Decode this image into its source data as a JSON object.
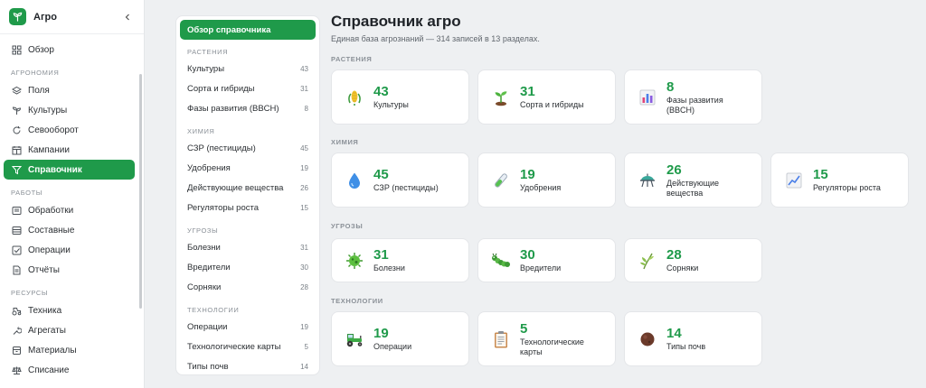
{
  "app": {
    "name": "Агро"
  },
  "sidebar": {
    "overview": "Обзор",
    "sections": [
      {
        "title": "АГРОНОМИЯ",
        "items": [
          {
            "label": "Поля",
            "icon": "layers-icon"
          },
          {
            "label": "Культуры",
            "icon": "sprout-icon"
          },
          {
            "label": "Севооборот",
            "icon": "rotate-icon"
          },
          {
            "label": "Кампании",
            "icon": "calendar-icon"
          },
          {
            "label": "Справочник",
            "icon": "funnel-icon",
            "active": true
          }
        ]
      },
      {
        "title": "РАБОТЫ",
        "items": [
          {
            "label": "Обработки",
            "icon": "list-icon"
          },
          {
            "label": "Составные",
            "icon": "stack-icon"
          },
          {
            "label": "Операции",
            "icon": "checkbox-icon"
          },
          {
            "label": "Отчёты",
            "icon": "document-icon"
          }
        ]
      },
      {
        "title": "РЕСУРСЫ",
        "items": [
          {
            "label": "Техника",
            "icon": "tractor-icon"
          },
          {
            "label": "Агрегаты",
            "icon": "wrench-icon"
          },
          {
            "label": "Материалы",
            "icon": "box-icon"
          },
          {
            "label": "Списание",
            "icon": "scale-icon"
          }
        ]
      }
    ]
  },
  "catalog_nav": {
    "overview": "Обзор справочника",
    "sections": [
      {
        "title": "РАСТЕНИЯ",
        "items": [
          {
            "label": "Культуры",
            "count": "43"
          },
          {
            "label": "Сорта и гибриды",
            "count": "31"
          },
          {
            "label": "Фазы развития (BBCH)",
            "count": "8"
          }
        ]
      },
      {
        "title": "ХИМИЯ",
        "items": [
          {
            "label": "СЗР (пестициды)",
            "count": "45"
          },
          {
            "label": "Удобрения",
            "count": "19"
          },
          {
            "label": "Действующие вещества",
            "count": "26"
          },
          {
            "label": "Регуляторы роста",
            "count": "15"
          }
        ]
      },
      {
        "title": "УГРОЗЫ",
        "items": [
          {
            "label": "Болезни",
            "count": "31"
          },
          {
            "label": "Вредители",
            "count": "30"
          },
          {
            "label": "Сорняки",
            "count": "28"
          }
        ]
      },
      {
        "title": "ТЕХНОЛОГИИ",
        "items": [
          {
            "label": "Операции",
            "count": "19"
          },
          {
            "label": "Технологические карты",
            "count": "5"
          },
          {
            "label": "Типы почв",
            "count": "14"
          }
        ]
      }
    ]
  },
  "main": {
    "title": "Справочник агро",
    "subtitle": "Единая база агрознаний — 314 записей в 13 разделах.",
    "groups": [
      {
        "title": "РАСТЕНИЯ",
        "cards": [
          {
            "count": "43",
            "label": "Культуры",
            "icon": "corn-icon"
          },
          {
            "count": "31",
            "label": "Сорта и гибриды",
            "icon": "seedling-icon"
          },
          {
            "count": "8",
            "label": "Фазы развития (BBCH)",
            "icon": "bar-chart-icon"
          }
        ]
      },
      {
        "title": "ХИМИЯ",
        "cards": [
          {
            "count": "45",
            "label": "СЗР (пестициды)",
            "icon": "droplet-icon"
          },
          {
            "count": "19",
            "label": "Удобрения",
            "icon": "test-tube-icon"
          },
          {
            "count": "26",
            "label": "Действующие вещества",
            "icon": "flask-icon"
          },
          {
            "count": "15",
            "label": "Регуляторы роста",
            "icon": "trend-chart-icon"
          }
        ]
      },
      {
        "title": "УГРОЗЫ",
        "cards": [
          {
            "count": "31",
            "label": "Болезни",
            "icon": "microbe-icon"
          },
          {
            "count": "30",
            "label": "Вредители",
            "icon": "caterpillar-icon"
          },
          {
            "count": "28",
            "label": "Сорняки",
            "icon": "weed-icon"
          }
        ]
      },
      {
        "title": "ТЕХНОЛОГИИ",
        "cards": [
          {
            "count": "19",
            "label": "Операции",
            "icon": "tractor-icon"
          },
          {
            "count": "5",
            "label": "Технологические карты",
            "icon": "clipboard-icon"
          },
          {
            "count": "14",
            "label": "Типы почв",
            "icon": "soil-icon"
          }
        ]
      }
    ]
  },
  "colors": {
    "accent": "#1f9a4a",
    "background": "#eef0f2",
    "panel": "#ffffff"
  }
}
